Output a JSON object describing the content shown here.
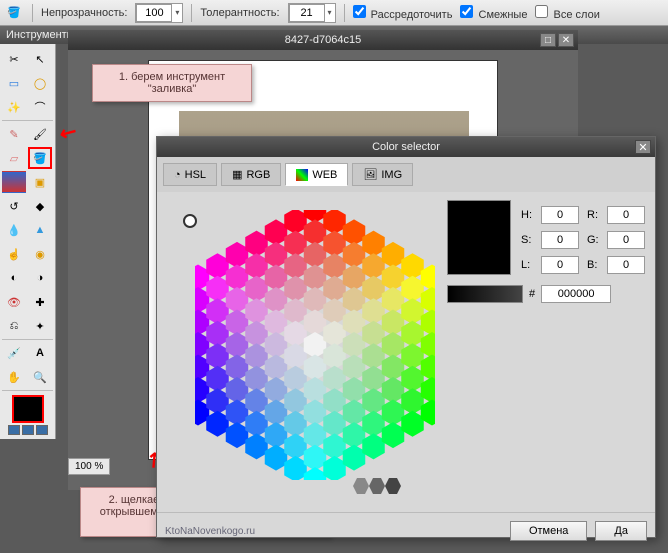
{
  "topbar": {
    "opacity_label": "Непрозрачность:",
    "opacity_value": "100",
    "tolerance_label": "Толерантность:",
    "tolerance_value": "21",
    "cb_scatter": "Рассредоточить",
    "cb_adjacent": "Смежные",
    "cb_alllayers": "Все слои"
  },
  "panel": {
    "tools_title": "Инструменты"
  },
  "doc": {
    "title": "8427-d7064c15",
    "zoom": "100 %"
  },
  "annot": {
    "a1": "1. берем инструмент \"заливка\"",
    "a2": "2. щелкаем по инструменту \"цвет\" и в открывшемся окне с палитрой выбираем нужный нам цвет."
  },
  "colorsel": {
    "title": "Color selector",
    "tabs": {
      "hsl": "HSL",
      "rgb": "RGB",
      "web": "WEB",
      "img": "IMG"
    },
    "labels": {
      "H": "H:",
      "S": "S:",
      "L": "L:",
      "R": "R:",
      "G": "G:",
      "B": "B:",
      "hash": "#"
    },
    "values": {
      "H": "0",
      "S": "0",
      "L": "0",
      "R": "0",
      "G": "0",
      "B": "0",
      "hex": "000000"
    },
    "credit": "KtoNaNovenkogo.ru",
    "cancel": "Отмена",
    "ok": "Да"
  }
}
